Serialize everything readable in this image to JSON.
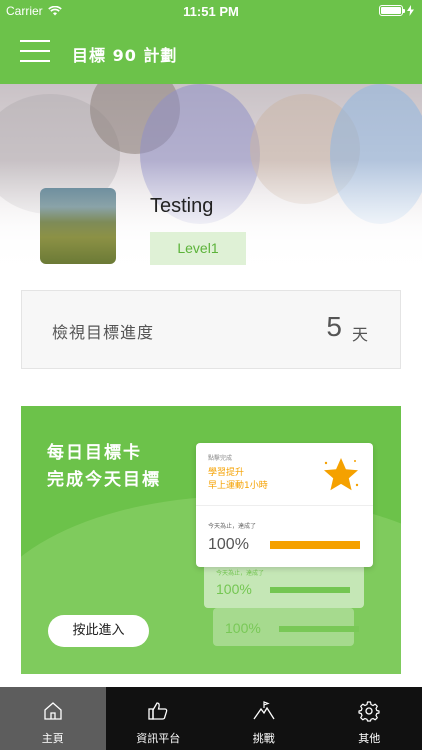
{
  "status_bar": {
    "carrier": "Carrier",
    "time": "11:51 PM"
  },
  "nav": {
    "title": "目標 90 計劃"
  },
  "profile": {
    "name": "Testing",
    "level": "Level1"
  },
  "progress": {
    "label": "檢視目標進度",
    "value": "5",
    "unit": "天"
  },
  "daily": {
    "title_line1": "每日目標卡",
    "title_line2": "完成今天目標",
    "button": "按此進入",
    "card": {
      "tag": "點擊完成",
      "goal_line1": "學習提升",
      "goal_line2": "早上運動1小時",
      "sub_label": "今天為止，達成了",
      "percent": "100%"
    },
    "back_cards": [
      {
        "sub_label": "今天為止，達成了",
        "percent": "100%"
      },
      {
        "percent": "100%"
      }
    ]
  },
  "tabs": [
    {
      "label": "主頁",
      "icon": "home-icon"
    },
    {
      "label": "資訊平台",
      "icon": "thumbs-up-icon"
    },
    {
      "label": "挑戰",
      "icon": "mountain-icon"
    },
    {
      "label": "其他",
      "icon": "gear-icon"
    }
  ],
  "colors": {
    "primary": "#6cc24a",
    "accent": "#f5a100",
    "tabbar": "#111111"
  }
}
